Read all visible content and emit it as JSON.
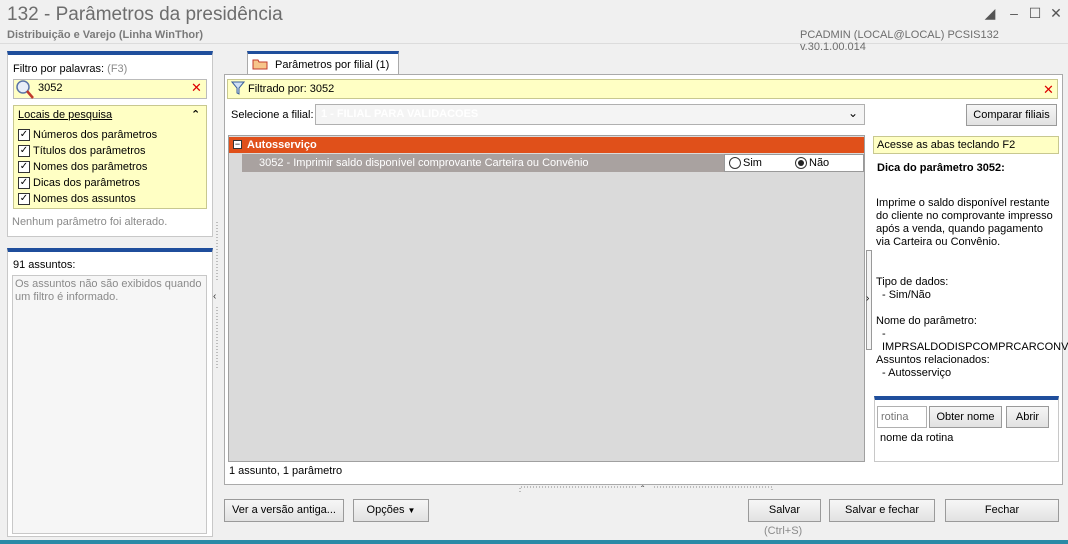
{
  "window": {
    "title": "132 - Parâmetros da presidência",
    "subtitle": "Distribuição e Varejo (Linha WinThor)",
    "user_info": "PCADMIN (LOCAL@LOCAL)   PCSIS132  v.30.1.00.014"
  },
  "left": {
    "filter_label": "Filtro por palavras:",
    "filter_hotkey": "(F3)",
    "search_value": "3052",
    "locais_title": "Locais de pesquisa",
    "locais": [
      {
        "label": "Números dos parâmetros",
        "checked": true
      },
      {
        "label": "Títulos dos parâmetros",
        "checked": true
      },
      {
        "label": "Nomes dos parâmetros",
        "checked": true
      },
      {
        "label": "Dicas dos parâmetros",
        "checked": true
      },
      {
        "label": "Nomes dos assuntos",
        "checked": true
      }
    ],
    "no_change_note": "Nenhum parâmetro foi alterado.",
    "assuntos_count": "91 assuntos:",
    "assuntos_note": "Os assuntos não são exibidos quando um filtro é informado."
  },
  "tab": {
    "label": "Parâmetros por filial  (1)"
  },
  "main": {
    "filtered_text": "Filtrado por: 3052",
    "select_filial_label": "Selecione a filial:",
    "select_filial_value": "1 - FILIAL PARA VALIDACOES",
    "compare_button": "Comparar filiais",
    "group_label": "Autosserviço",
    "param_row": "3052 - Imprimir saldo disponível comprovante Carteira ou Convênio",
    "radio_sim": "Sim",
    "radio_nao": "Não",
    "footer_count": "1 assunto, 1 parâmetro"
  },
  "right": {
    "hint_tabs": "Acesse as abas teclando F2",
    "tip_title": "Dica do parâmetro 3052:",
    "tip_body": "Imprime o saldo disponível restante do cliente no comprovante impresso após a venda, quando pagamento via Carteira ou Convênio.",
    "data_type_label": "Tipo de dados:",
    "data_type_value": "- Sim/Não",
    "param_name_label": "Nome do parâmetro:",
    "param_name_value": "- IMPRSALDODISPCOMPRCARCONV",
    "related_label": "Assuntos relacionados:",
    "related_value": "- Autosserviço",
    "rotina_placeholder": "rotina",
    "obter_nome_button": "Obter nome",
    "abrir_button": "Abrir",
    "nome_rotina_label": "nome da rotina"
  },
  "footer": {
    "old_version_button": "Ver a versão antiga...",
    "options_button": "Opções",
    "save_button": "Salvar",
    "save_hotkey": "(Ctrl+S)",
    "save_close_button": "Salvar e fechar",
    "close_button": "Fechar"
  },
  "colors": {
    "accent_blue": "#1f4e9c",
    "group_orange": "#e0501a",
    "highlight_yellow": "#ffffc4"
  }
}
